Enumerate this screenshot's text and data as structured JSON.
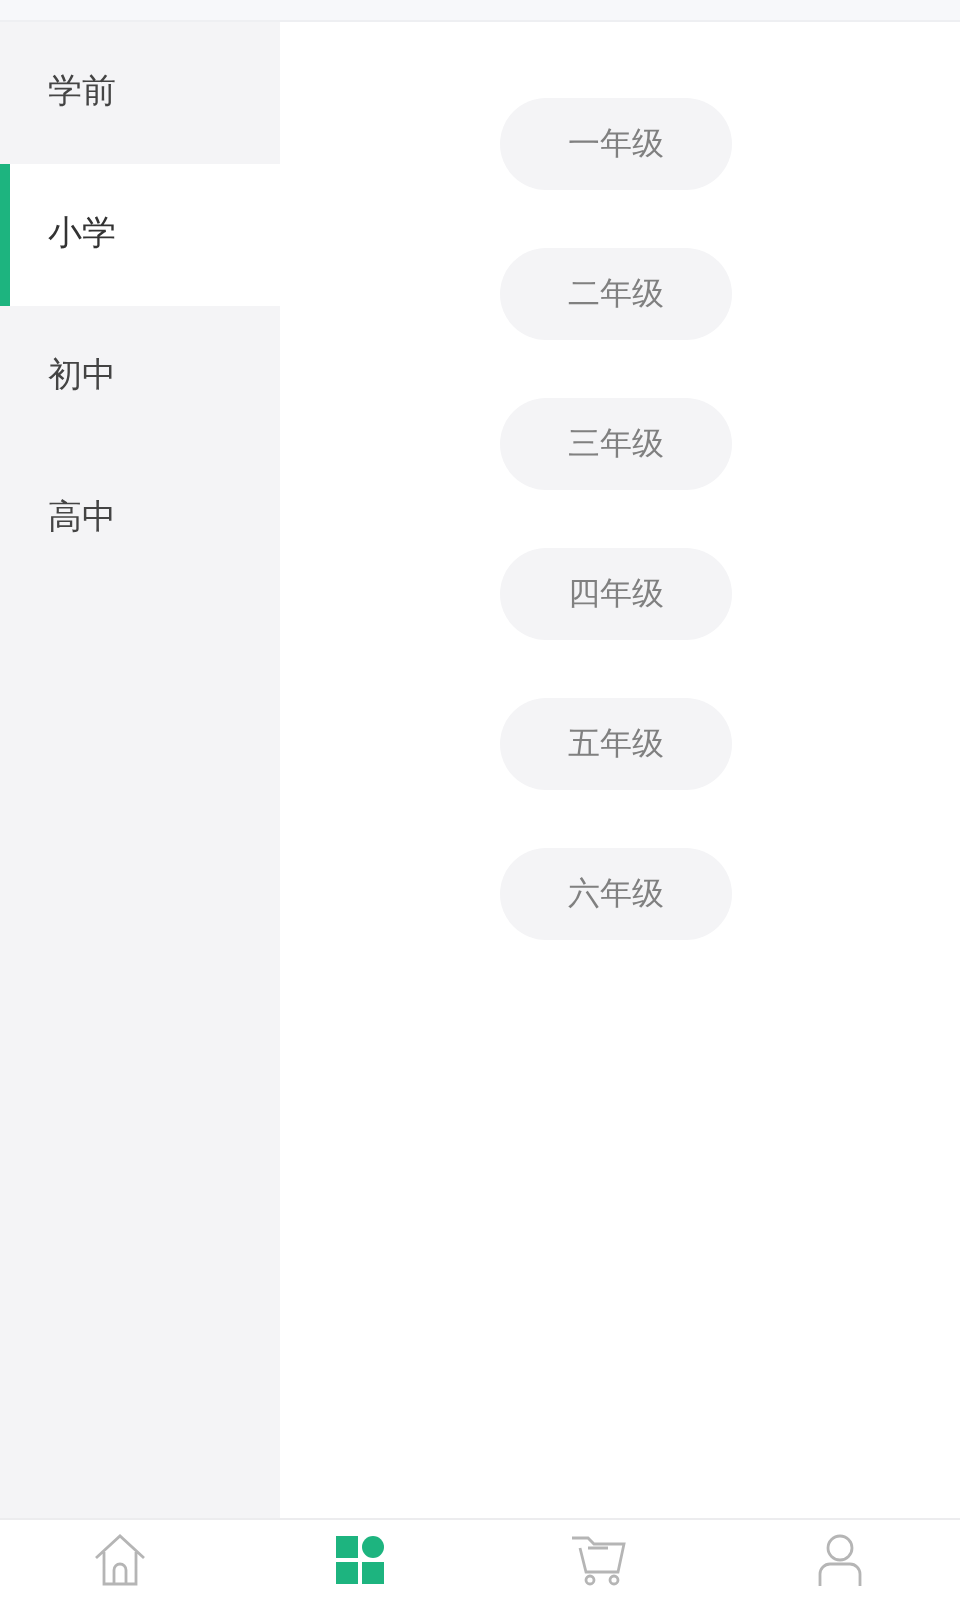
{
  "sidebar": {
    "items": [
      {
        "label": "学前",
        "selected": false
      },
      {
        "label": "小学",
        "selected": true
      },
      {
        "label": "初中",
        "selected": false
      },
      {
        "label": "高中",
        "selected": false
      }
    ]
  },
  "grades": [
    "一年级",
    "二年级",
    "三年级",
    "四年级",
    "五年级",
    "六年级"
  ],
  "bottom_nav": [
    {
      "kind": "home",
      "selected": false
    },
    {
      "kind": "category",
      "selected": true
    },
    {
      "kind": "cart",
      "selected": false
    },
    {
      "kind": "profile",
      "selected": false
    }
  ]
}
